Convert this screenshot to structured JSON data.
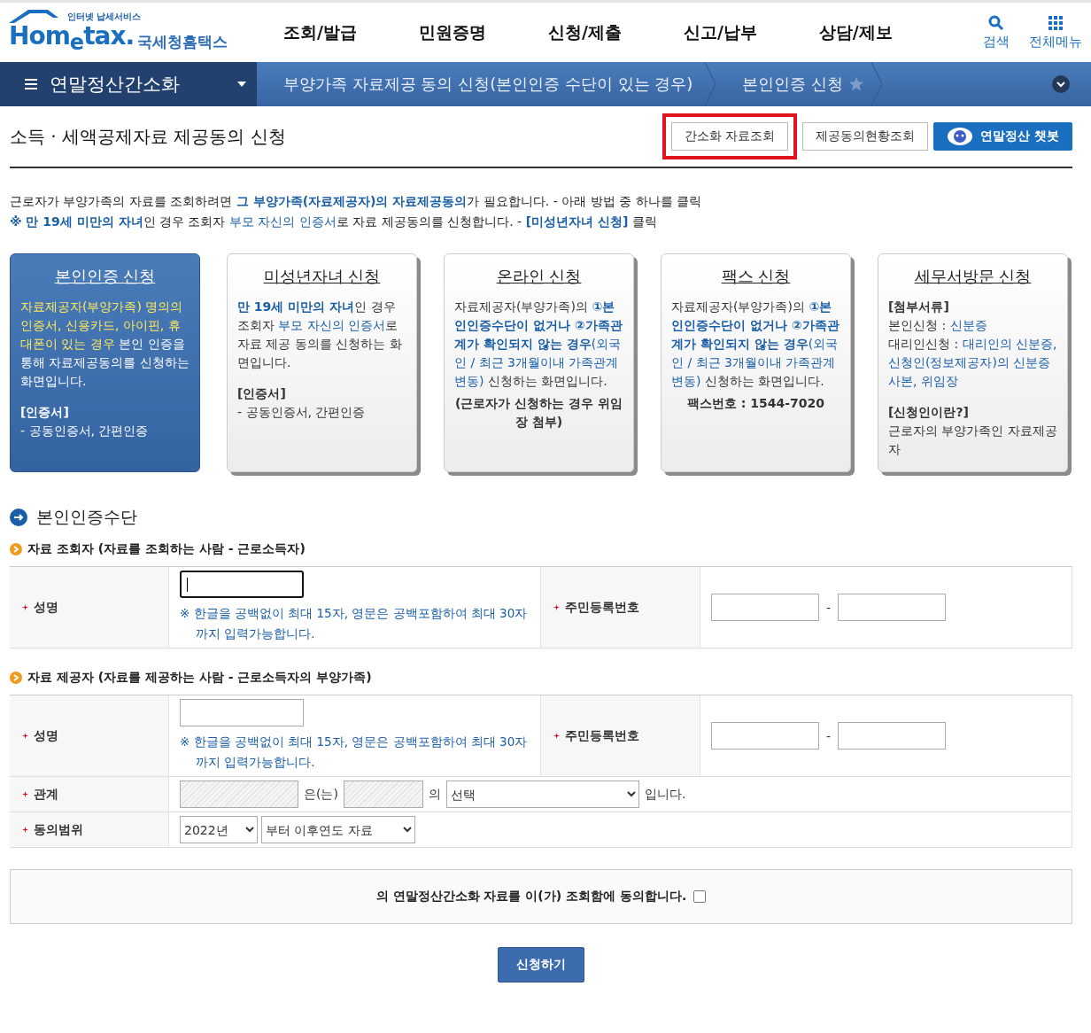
{
  "header": {
    "logo": {
      "tagline": "인터넷 납세서비스",
      "wordmark": "Hom$_{e}$tax.",
      "name": "국세청홈택스"
    },
    "nav": [
      "조회/발급",
      "민원증명",
      "신청/제출",
      "신고/납부",
      "상담/제보"
    ],
    "tools": [
      {
        "kind": "search",
        "label": "검색"
      },
      {
        "kind": "grid",
        "label": "전체메뉴"
      }
    ]
  },
  "breadcrumb": {
    "menu": "연말정산간소화",
    "crumbs": [
      "부양가족 자료제공 동의 신청(본인인증 수단이 있는 경우)",
      "본인인증 신청"
    ],
    "favorite": false
  },
  "page_title": "소득 · 세액공제자료 제공동의 신청",
  "buttons": [
    {
      "kind": "plain",
      "label": "간소화 자료조회",
      "highlighted": true
    },
    {
      "kind": "plain",
      "label": "제공동의현황조회",
      "highlighted": false
    },
    {
      "kind": "chatbot",
      "label": "연말정산 챗봇",
      "highlighted": false
    }
  ],
  "intro": [
    [
      {
        "kind": "plain",
        "text": "근로자가 부양가족의 자료를 조회하려면 "
      },
      {
        "kind": "strong",
        "text": "그 부양가족(자료제공자)의 자료제공동의"
      },
      {
        "kind": "plain",
        "text": "가 필요합니다. - 아래 방법 중 하나를 클릭"
      }
    ],
    [
      {
        "kind": "strong",
        "text": "※ 만 19세 미만의 자녀"
      },
      {
        "kind": "plain",
        "text": "인 경우 조회자 "
      },
      {
        "kind": "blue",
        "text": "부모 자신의 인증서"
      },
      {
        "kind": "plain",
        "text": "로 자료 제공동의를 신청합니다. - "
      },
      {
        "kind": "strong",
        "text": "[미성년자녀 신청]"
      },
      {
        "kind": "plain",
        "text": " 클릭"
      }
    ]
  ],
  "cards": [
    {
      "title": "본인인증 신청",
      "selected": true,
      "blocks": [
        {
          "kind": "text",
          "runs": [
            {
              "kind": "blue",
              "text": "자료제공자(부양가족) 명의의 인증서, 신용카드, 아이핀,  휴대폰이 있는 경우"
            },
            {
              "kind": "plain",
              "text": " 본인 인증을 통해 자료제공동의를 신청하는 화면입니다."
            }
          ]
        },
        {
          "kind": "heading",
          "text": "[인증서]"
        },
        {
          "kind": "text",
          "runs": [
            {
              "kind": "plain",
              "text": "- 공동인증서, 간편인증"
            }
          ]
        }
      ]
    },
    {
      "title": "미성년자녀 신청",
      "selected": false,
      "blocks": [
        {
          "kind": "text",
          "runs": [
            {
              "kind": "strong",
              "text": "만 19세 미만의 자녀"
            },
            {
              "kind": "plain",
              "text": "인 경우 조회자 "
            },
            {
              "kind": "blue",
              "text": "부모 자신의 인증서"
            },
            {
              "kind": "plain",
              "text": "로 자료 제공 동의를 신청하는 화면입니다."
            }
          ]
        },
        {
          "kind": "heading",
          "text": "[인증서]"
        },
        {
          "kind": "text",
          "runs": [
            {
              "kind": "plain",
              "text": "- 공동인증서, 간편인증"
            }
          ]
        }
      ]
    },
    {
      "title": "온라인 신청",
      "selected": false,
      "blocks": [
        {
          "kind": "text",
          "runs": [
            {
              "kind": "plain",
              "text": "자료제공자(부양가족)의 "
            },
            {
              "kind": "strong",
              "text": "①본인인증수단이 없거나 ②가족관계가 확인되지 않는 경우"
            },
            {
              "kind": "blue",
              "text": "(외국인 / 최근 3개월이내 가족관계 변동)"
            },
            {
              "kind": "plain",
              "text": " 신청하는 화면입니다."
            }
          ]
        },
        {
          "kind": "center",
          "text": "(근로자가 신청하는 경우 위임장 첨부)"
        }
      ]
    },
    {
      "title": "팩스 신청",
      "selected": false,
      "blocks": [
        {
          "kind": "text",
          "runs": [
            {
              "kind": "plain",
              "text": "자료제공자(부양가족)의 "
            },
            {
              "kind": "strong",
              "text": "①본인인증수단이 없거나 ②가족관계가 확인되지 않는 경우"
            },
            {
              "kind": "blue",
              "text": "(외국인 / 최근 3개월이내 가족관계 변동)"
            },
            {
              "kind": "plain",
              "text": " 신청하는 화면입니다."
            }
          ]
        },
        {
          "kind": "center",
          "text": "팩스번호 : 1544-7020"
        }
      ]
    },
    {
      "title": "세무서방문 신청",
      "selected": false,
      "blocks": [
        {
          "kind": "heading",
          "text": "[첨부서류]"
        },
        {
          "kind": "text",
          "runs": [
            {
              "kind": "plain",
              "text": "본인신청 : "
            },
            {
              "kind": "blue",
              "text": "신분증"
            }
          ]
        },
        {
          "kind": "text",
          "runs": [
            {
              "kind": "plain",
              "text": "대리인신청 : "
            },
            {
              "kind": "blue",
              "text": "대리인의 신분증, 신청인(정보제공자)의 신분증 사본, 위임장"
            }
          ]
        },
        {
          "kind": "heading",
          "text": "[신청인이란?]"
        },
        {
          "kind": "text",
          "runs": [
            {
              "kind": "plain",
              "text": "근로자의 부양가족인 자료제공자"
            }
          ]
        }
      ]
    }
  ],
  "section_title": "본인인증수단",
  "forms": [
    {
      "title": "자료 조회자 (자료를 조회하는 사람 - 근로소득자)",
      "rows": [
        {
          "kind": "name_id",
          "label": "성명",
          "required": true,
          "focused": true,
          "note": "※ 한글을 공백없이 최대 15자, 영문은 공백포함하여 최대 30자까지 입력가능합니다.",
          "id_label": "주민등록번호",
          "id_required": true,
          "id_separator": "-"
        }
      ]
    },
    {
      "title": "자료 제공자 (자료를 제공하는 사람 - 근로소득자의 부양가족)",
      "rows": [
        {
          "kind": "name_id",
          "label": "성명",
          "required": true,
          "focused": false,
          "note": "※ 한글을 공백없이 최대 15자, 영문은 공백포함하여 최대 30자까지 입력가능합니다.",
          "id_label": "주민등록번호",
          "id_required": true,
          "id_separator": "-"
        },
        {
          "kind": "relation",
          "label": "관계",
          "required": true,
          "texts": [
            "은(는)",
            "의",
            "입니다."
          ],
          "select": "선택"
        },
        {
          "kind": "range",
          "label": "동의범위",
          "required": true,
          "selects": [
            "2022년",
            "부터 이후연도 자료"
          ]
        }
      ]
    }
  ],
  "consent": {
    "text": "의 연말정산간소화 자료를 이(가) 조회함에 동의합니다.",
    "checked": false
  },
  "submit": "신청하기"
}
